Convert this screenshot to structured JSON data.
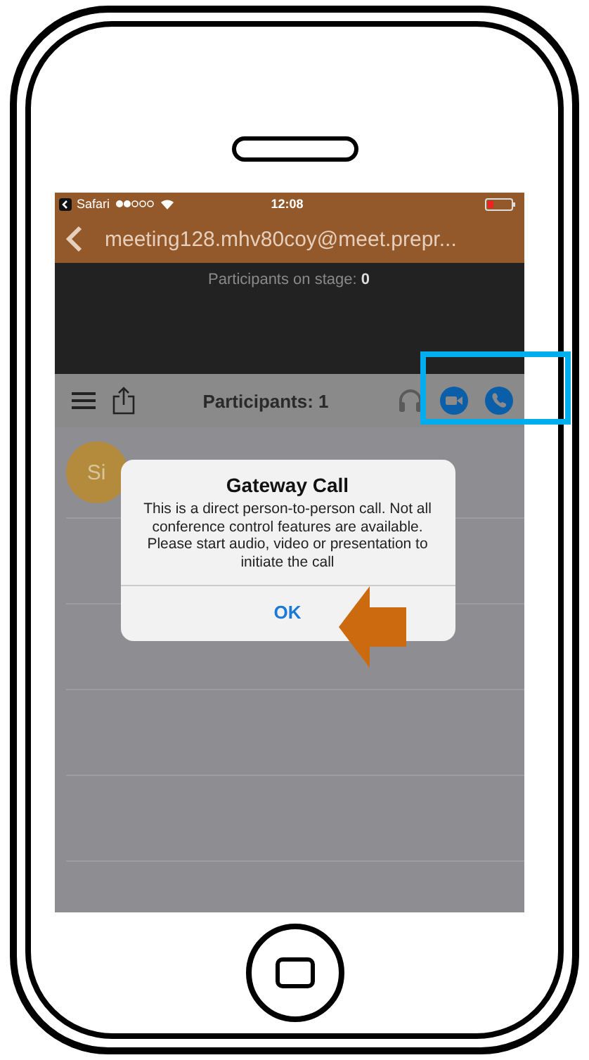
{
  "status_bar": {
    "back_app": "Safari",
    "time": "12:08"
  },
  "nav_bar": {
    "title": "meeting128.mhv80coy@meet.prepr..."
  },
  "stage": {
    "text": "Participants on stage: **0**"
  },
  "toolbar": {
    "title": "Participants: 1"
  },
  "participants": [
    {
      "initials": "Si"
    }
  ],
  "dialog": {
    "title": "Gateway Call",
    "message": "This is a direct person-to-person call. Not all conference control features are available. Please start audio, video or presentation to initiate the call",
    "button": "OK"
  }
}
